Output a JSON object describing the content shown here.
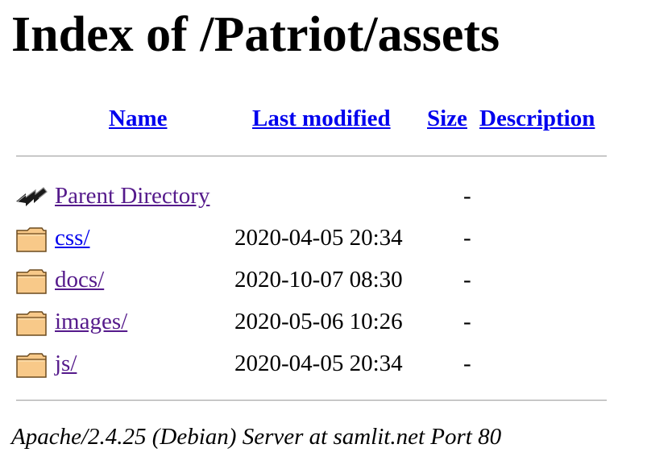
{
  "page": {
    "heading": "Index of /Patriot/assets"
  },
  "columns": {
    "name": "Name",
    "last_modified": "Last modified",
    "size": "Size",
    "description": "Description"
  },
  "entries": [
    {
      "name": "Parent Directory",
      "last_modified": "",
      "size": "-",
      "description": "",
      "icon": "back-arrow-icon",
      "visited": true
    },
    {
      "name": "css/",
      "last_modified": "2020-04-05 20:34",
      "size": "-",
      "description": "",
      "icon": "folder-icon",
      "visited": false
    },
    {
      "name": "docs/",
      "last_modified": "2020-10-07 08:30",
      "size": "-",
      "description": "",
      "icon": "folder-icon",
      "visited": true
    },
    {
      "name": "images/",
      "last_modified": "2020-05-06 10:26",
      "size": "-",
      "description": "",
      "icon": "folder-icon",
      "visited": true
    },
    {
      "name": "js/",
      "last_modified": "2020-04-05 20:34",
      "size": "-",
      "description": "",
      "icon": "folder-icon",
      "visited": true
    }
  ],
  "footer": {
    "server_signature": "Apache/2.4.25 (Debian) Server at samlit.net Port 80"
  },
  "colors": {
    "link": "#0000ee",
    "visited_link": "#551a8b",
    "folder_fill": "#f8c989",
    "folder_outline": "#6b4a1e"
  }
}
